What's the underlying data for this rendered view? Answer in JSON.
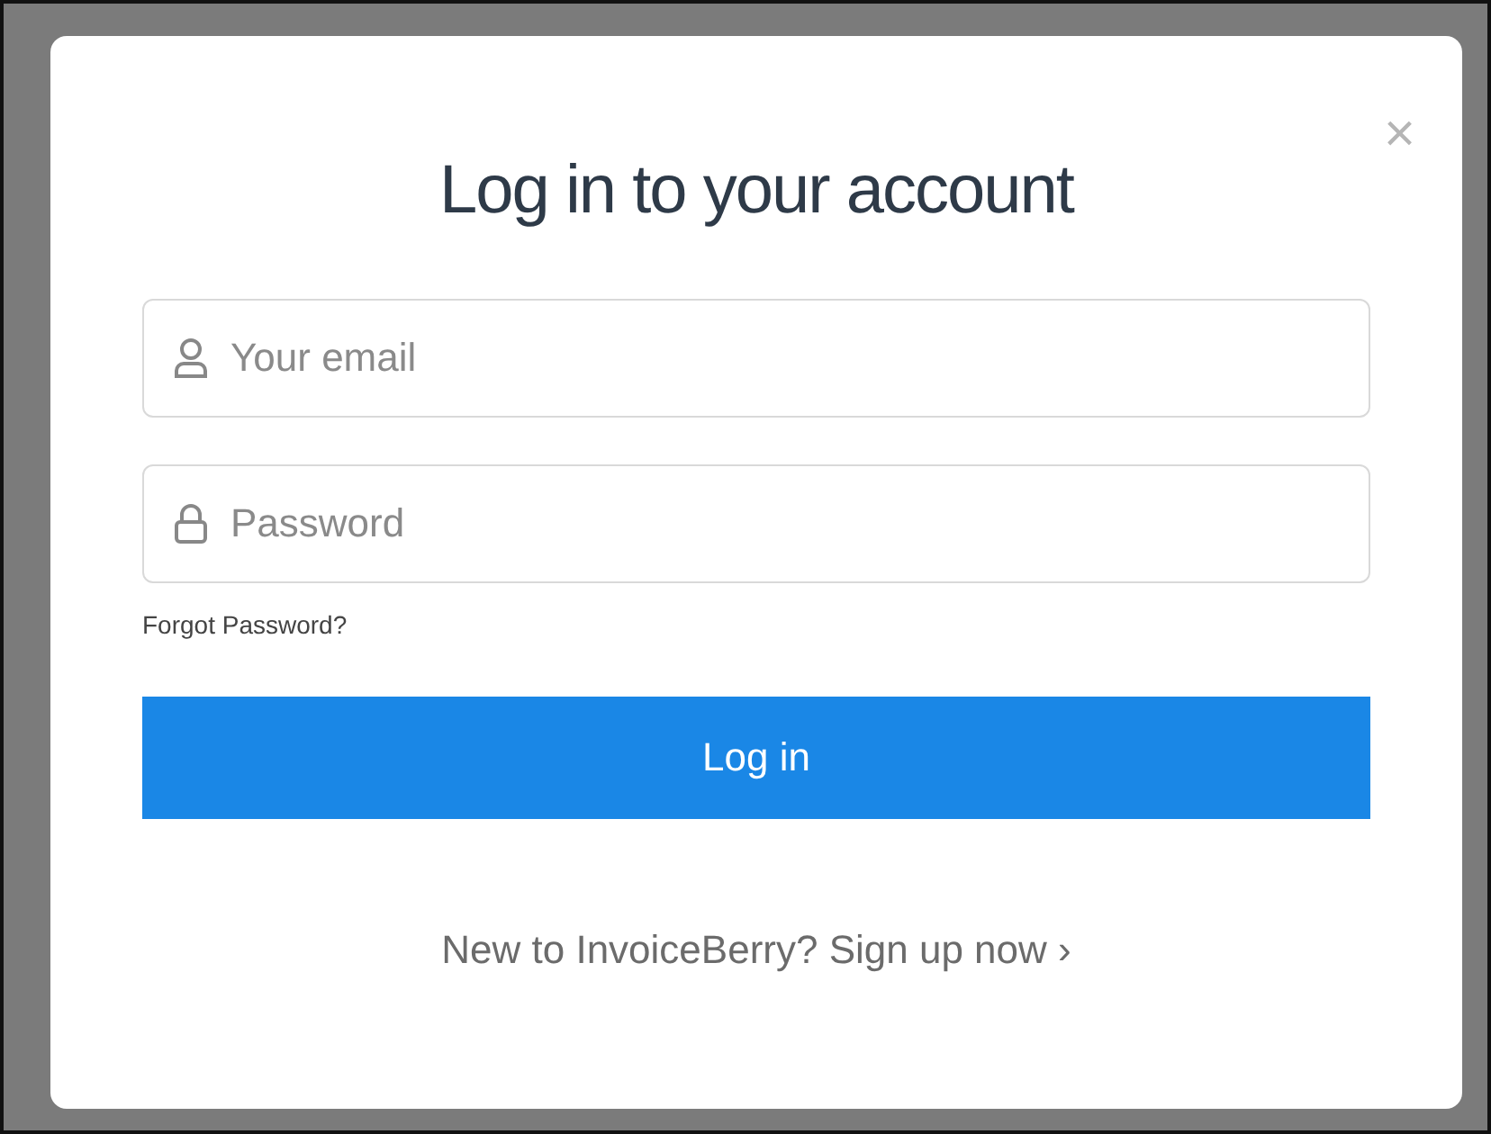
{
  "dialog": {
    "title": "Log in to your account",
    "close": "×",
    "fields": [
      {
        "kind": "email",
        "placeholder": "Your email"
      },
      {
        "kind": "password",
        "placeholder": "Password"
      }
    ],
    "forgot_link": "Forgot Password?",
    "submit": "Log in",
    "signup_link": "New to InvoiceBerry? Sign up now ›"
  }
}
